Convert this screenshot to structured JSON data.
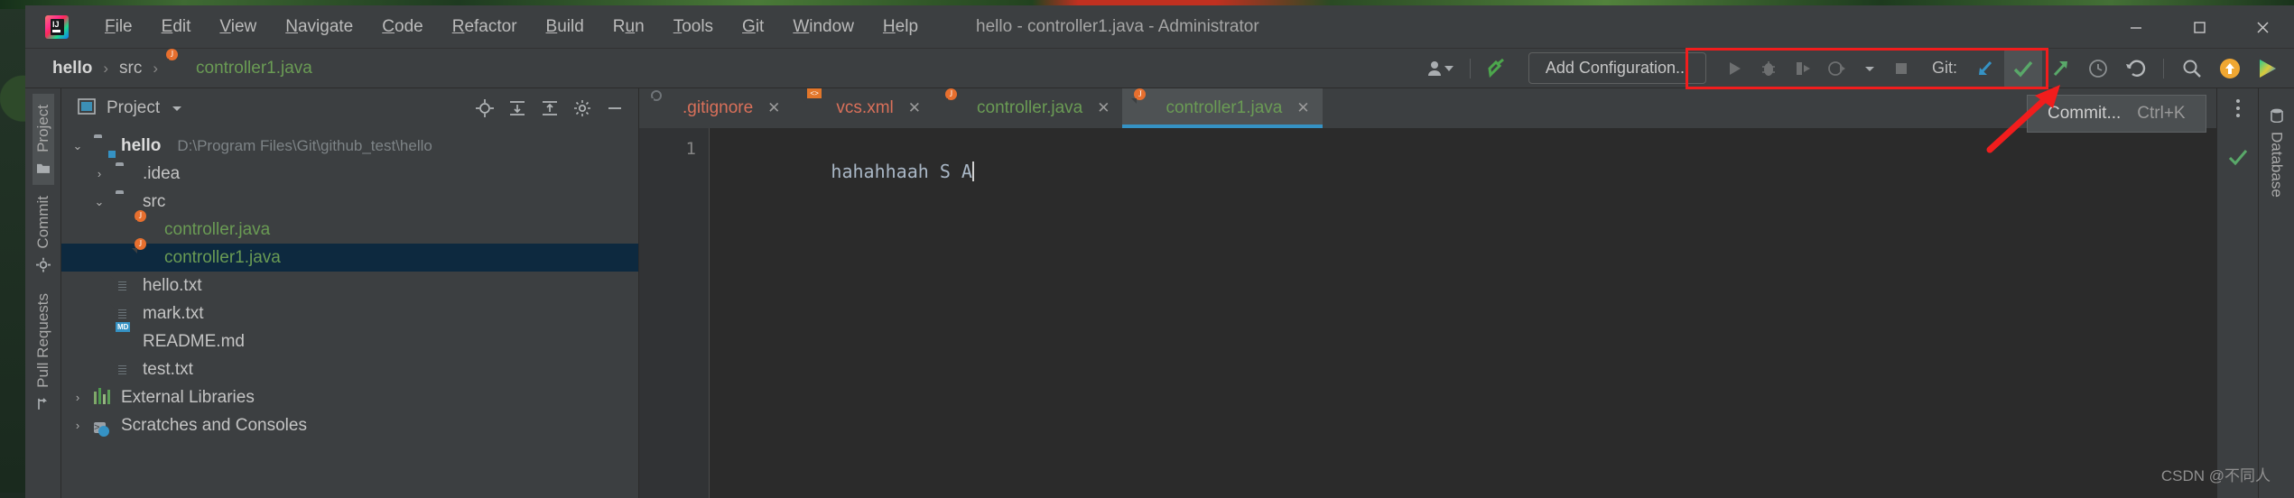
{
  "window": {
    "title": "hello - controller1.java - Administrator",
    "controls": {
      "minimize": "—",
      "maximize": "☐",
      "close": "✕"
    }
  },
  "menubar": {
    "items": [
      {
        "label": "File",
        "mnemonic": "F"
      },
      {
        "label": "Edit",
        "mnemonic": "E"
      },
      {
        "label": "View",
        "mnemonic": "V"
      },
      {
        "label": "Navigate",
        "mnemonic": "N"
      },
      {
        "label": "Code",
        "mnemonic": "C"
      },
      {
        "label": "Refactor",
        "mnemonic": "R"
      },
      {
        "label": "Build",
        "mnemonic": "B"
      },
      {
        "label": "Run",
        "mnemonic": "u"
      },
      {
        "label": "Tools",
        "mnemonic": "T"
      },
      {
        "label": "Git",
        "mnemonic": "G"
      },
      {
        "label": "Window",
        "mnemonic": "W"
      },
      {
        "label": "Help",
        "mnemonic": "H"
      }
    ]
  },
  "navbar": {
    "breadcrumbs": [
      {
        "label": "hello",
        "style": "bold"
      },
      {
        "label": "src",
        "style": "normal"
      },
      {
        "label": "controller1.java",
        "style": "green"
      }
    ],
    "separator": "›",
    "add_configuration": "Add Configuration...",
    "git_label": "Git:",
    "icons": [
      "user-settings-icon",
      "build-hammer-icon",
      "run-icon",
      "debug-icon",
      "run-coverage-icon",
      "profiler-icon",
      "dropdown-icon",
      "stop-icon",
      "git-update-icon",
      "git-commit-icon",
      "git-push-icon",
      "git-history-icon",
      "git-rollback-icon",
      "search-everywhere-icon",
      "notification-icon",
      "ide-play-icon"
    ]
  },
  "tooltip": {
    "label": "Commit...",
    "shortcut": "Ctrl+K"
  },
  "left_rail": {
    "items": [
      {
        "label": "Project",
        "icon": "folder-icon",
        "active": true
      },
      {
        "label": "Commit",
        "icon": "commit-icon",
        "active": false
      },
      {
        "label": "Pull Requests",
        "icon": "pull-request-icon",
        "active": false
      }
    ]
  },
  "right_rail": {
    "items": [
      {
        "label": "Database",
        "icon": "database-icon"
      }
    ]
  },
  "project_tool_window": {
    "title": "Project",
    "dropdown_icon": "chevron-down-icon",
    "actions": [
      "locate-icon",
      "expand-all-icon",
      "collapse-all-icon",
      "settings-gear-icon",
      "hide-icon"
    ],
    "tree": [
      {
        "indent": 0,
        "arrow": "⌄",
        "icon": "project-folder-icon",
        "label": "hello",
        "style": "bold",
        "path": "D:\\Program Files\\Git\\github_test\\hello",
        "selected": false
      },
      {
        "indent": 1,
        "arrow": "›",
        "icon": "folder-icon",
        "label": ".idea",
        "style": "normal",
        "path": "",
        "selected": false
      },
      {
        "indent": 1,
        "arrow": "⌄",
        "icon": "folder-icon",
        "label": "src",
        "style": "normal",
        "path": "",
        "selected": false
      },
      {
        "indent": 2,
        "arrow": "",
        "icon": "java-file-icon",
        "label": "controller.java",
        "style": "green",
        "path": "",
        "selected": false
      },
      {
        "indent": 2,
        "arrow": "",
        "icon": "java-file-icon",
        "label": "controller1.java",
        "style": "green",
        "path": "",
        "selected": true
      },
      {
        "indent": 1,
        "arrow": "",
        "icon": "text-file-icon",
        "label": "hello.txt",
        "style": "normal",
        "path": "",
        "selected": false
      },
      {
        "indent": 1,
        "arrow": "",
        "icon": "text-file-icon",
        "label": "mark.txt",
        "style": "normal",
        "path": "",
        "selected": false
      },
      {
        "indent": 1,
        "arrow": "",
        "icon": "markdown-file-icon",
        "label": "README.md",
        "style": "normal",
        "path": "",
        "selected": false
      },
      {
        "indent": 1,
        "arrow": "",
        "icon": "text-file-icon",
        "label": "test.txt",
        "style": "normal",
        "path": "",
        "selected": false
      },
      {
        "indent": 0,
        "arrow": "›",
        "icon": "external-libraries-icon",
        "label": "External Libraries",
        "style": "normal",
        "path": "",
        "selected": false
      },
      {
        "indent": 0,
        "arrow": "›",
        "icon": "scratches-icon",
        "label": "Scratches and Consoles",
        "style": "normal",
        "path": "",
        "selected": false
      }
    ]
  },
  "editor": {
    "tabs": [
      {
        "label": ".gitignore",
        "icon": "gitignore-file-icon",
        "color": "redx",
        "active": false,
        "close": "✕"
      },
      {
        "label": "vcs.xml",
        "icon": "xml-file-icon",
        "color": "redx",
        "active": false,
        "close": "✕"
      },
      {
        "label": "controller.java",
        "icon": "java-file-icon",
        "color": "green",
        "active": false,
        "close": "✕"
      },
      {
        "label": "controller1.java",
        "icon": "java-file-icon",
        "color": "green",
        "active": true,
        "close": "✕"
      }
    ],
    "line_numbers": [
      "1"
    ],
    "lines": [
      "hahahhaah S A"
    ]
  },
  "watermark": "CSDN @不同人",
  "colors": {
    "accent_blue": "#3592c4",
    "git_box_red": "#f11d1d",
    "green_text": "#6a9b54",
    "selection_blue": "#0d293f",
    "toolbar_bg": "#3c3f41",
    "editor_bg": "#2b2b2b"
  }
}
